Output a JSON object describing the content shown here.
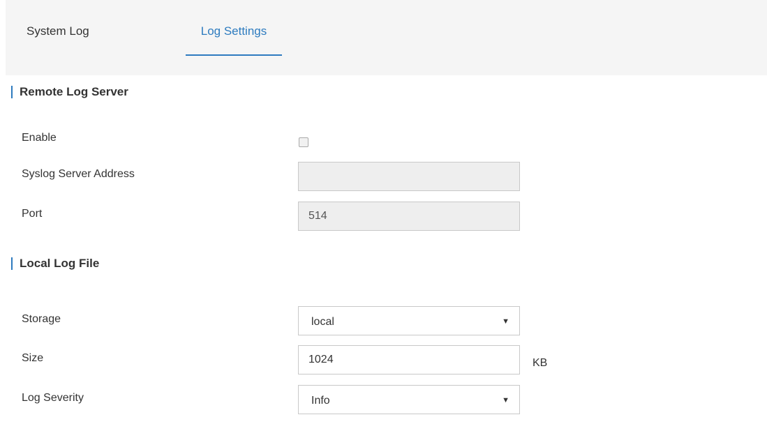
{
  "tabs": [
    {
      "label": "System Log",
      "active": false
    },
    {
      "label": "Log Settings",
      "active": true
    }
  ],
  "accent_color": "#2d7bbf",
  "remote": {
    "title": "Remote Log Server",
    "enable_label": "Enable",
    "enable_checked": false,
    "address_label": "Syslog Server Address",
    "address_value": "",
    "port_label": "Port",
    "port_value": "514"
  },
  "local": {
    "title": "Local Log File",
    "storage_label": "Storage",
    "storage_value": "local",
    "size_label": "Size",
    "size_value": "1024",
    "size_unit": "KB",
    "severity_label": "Log Severity",
    "severity_value": "Info"
  }
}
